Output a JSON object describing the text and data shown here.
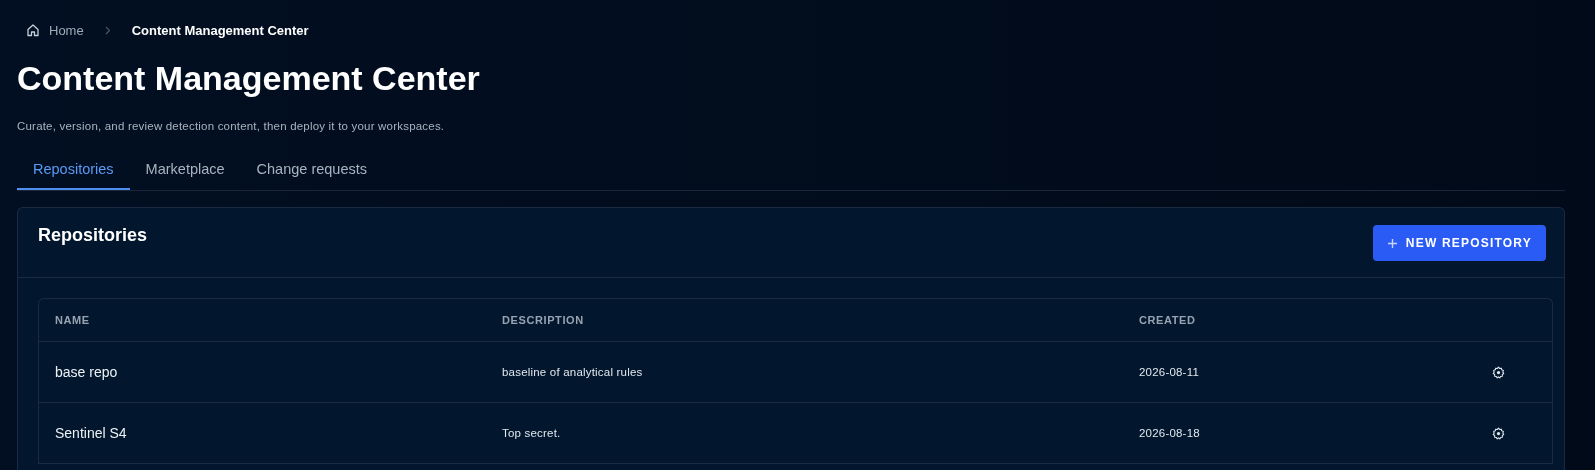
{
  "breadcrumb": [
    {
      "label": "Home",
      "current": false
    },
    {
      "label": "Content Management Center",
      "current": true
    }
  ],
  "title": "Content Management Center",
  "subtitle": "Curate, version, and review detection content, then deploy it to your workspaces.",
  "tabs": [
    {
      "label": "Repositories",
      "selected": true
    },
    {
      "label": "Marketplace",
      "selected": false
    },
    {
      "label": "Change requests",
      "selected": false
    }
  ],
  "card": {
    "title": "Repositories",
    "button": "NEW REPOSITORY",
    "table": {
      "columns": [
        "NAME",
        "DESCRIPTION",
        "CREATED"
      ],
      "rows": [
        {
          "name": "base repo",
          "description": "baseline of analytical rules",
          "created": "2026-08-11"
        },
        {
          "name": "Sentinel S4",
          "description": "Top secret.",
          "created": "2026-08-18"
        }
      ]
    }
  }
}
